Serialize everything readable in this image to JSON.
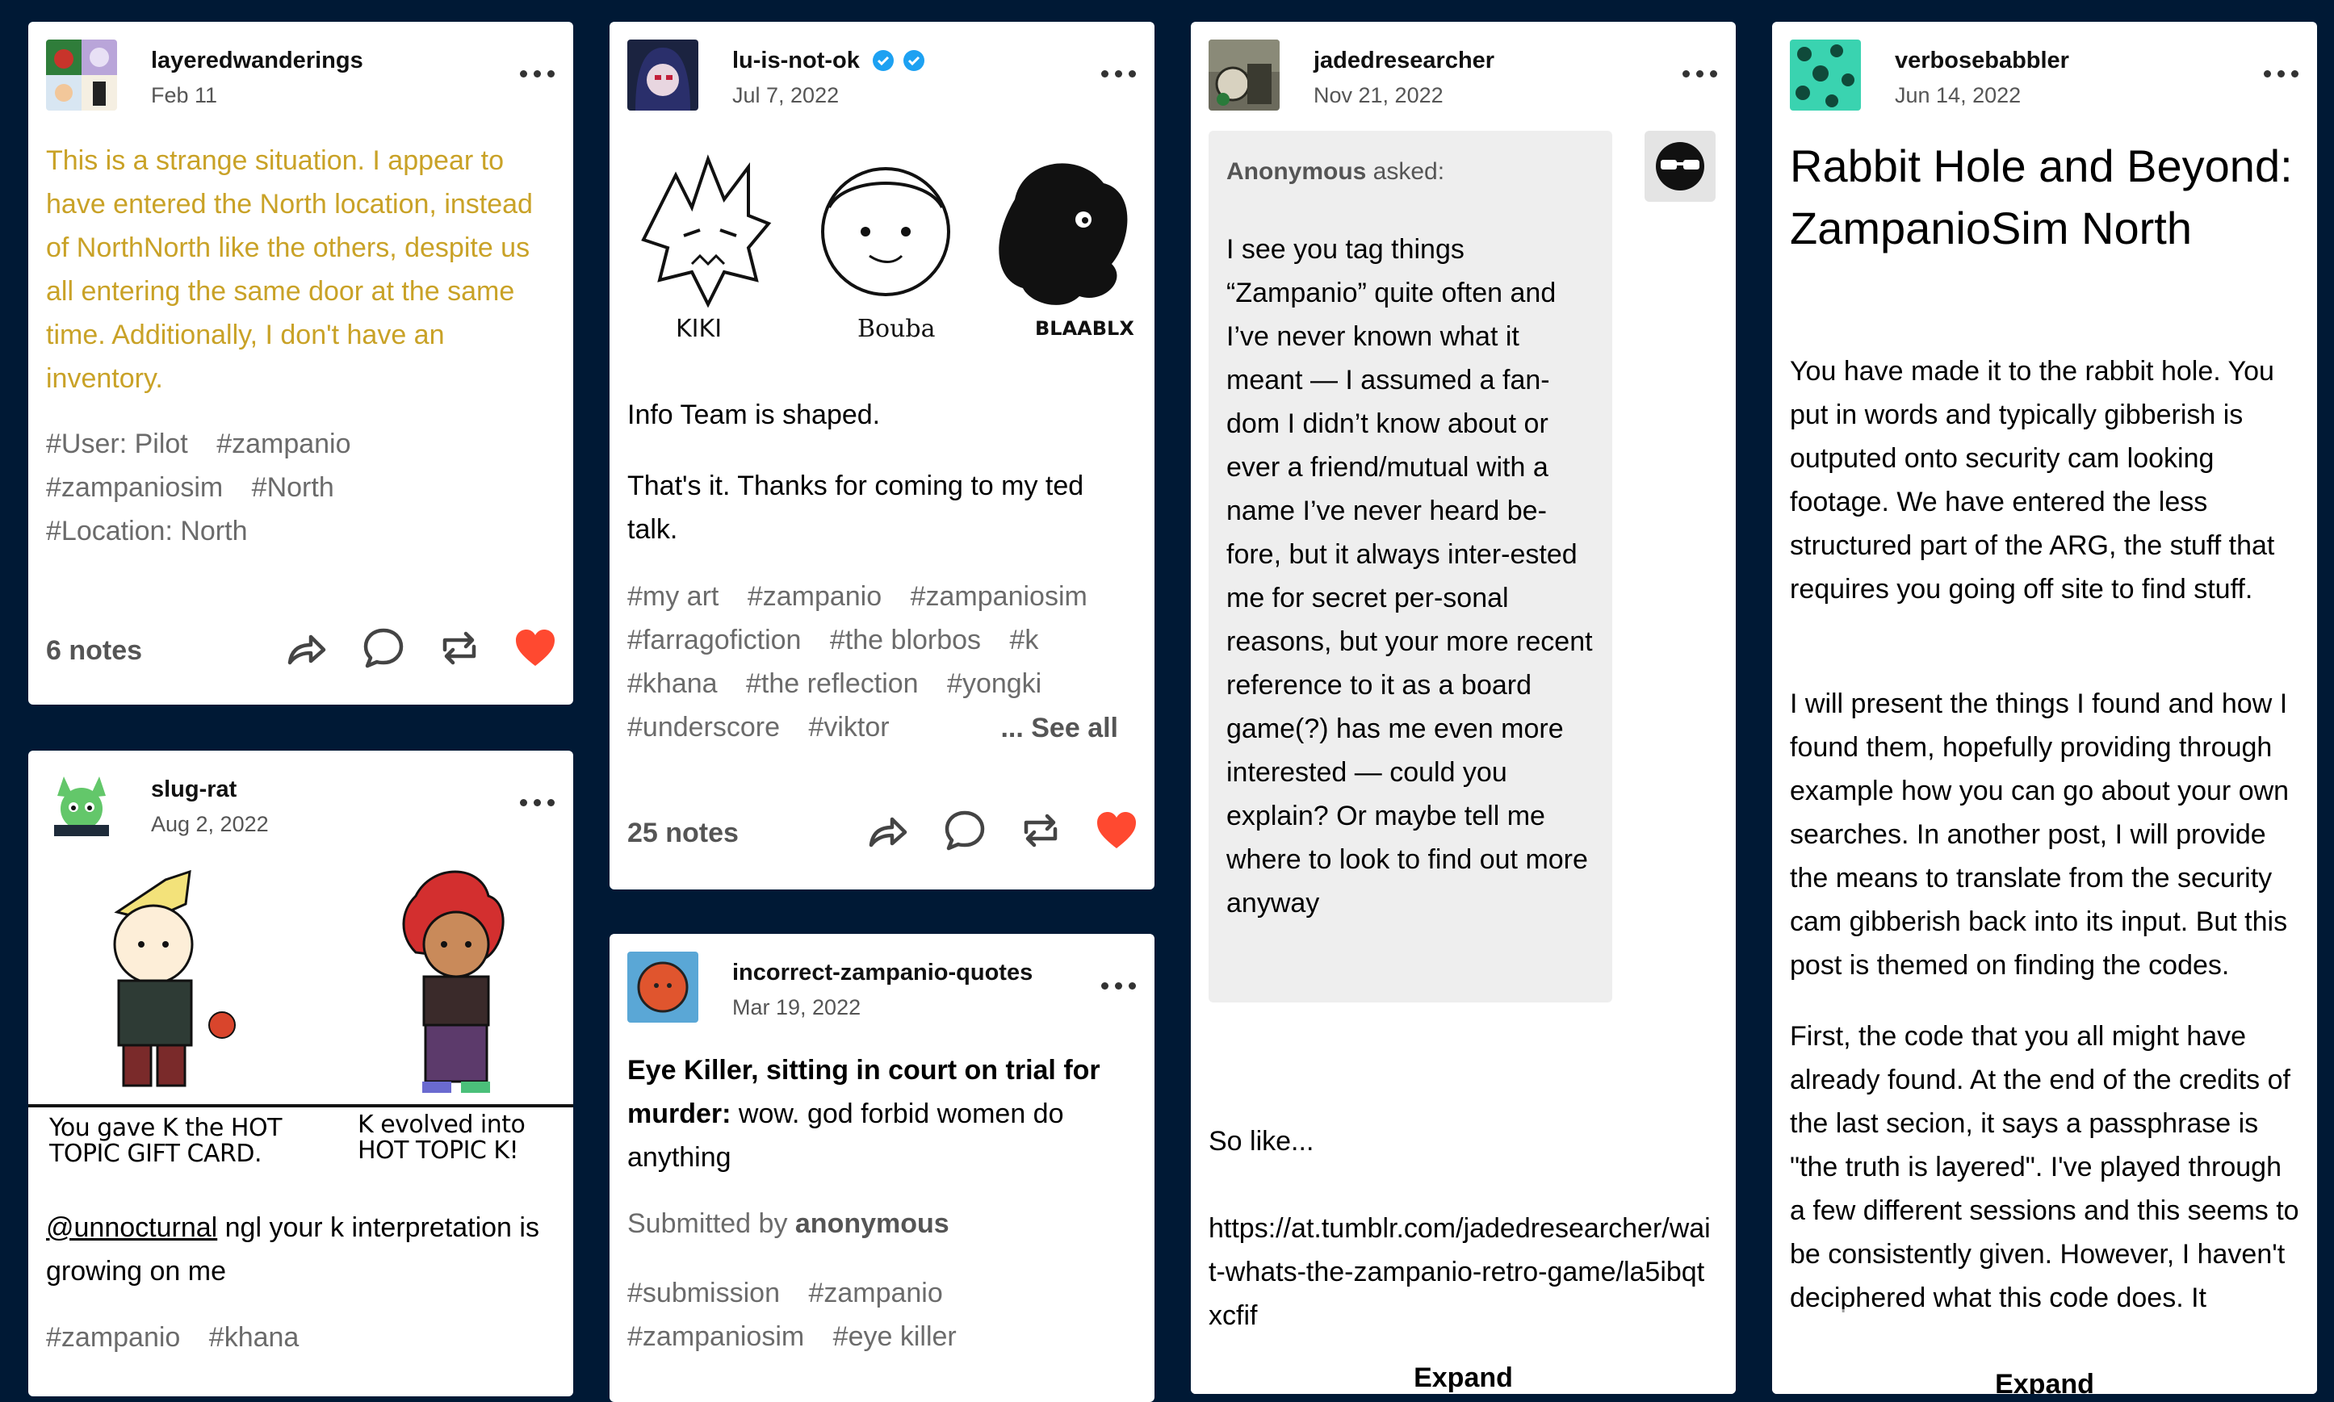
{
  "colors": {
    "background": "#001935",
    "card": "#ffffff",
    "accent_yellow": "#c9a227",
    "like_red": "#ff4930",
    "tag_gray": "#6b6b6b",
    "verified_blue": "#1da1f2"
  },
  "posts": {
    "layered": {
      "username": "layeredwanderings",
      "date": "Feb 11",
      "text": "This is a strange situation. I appear to have entered the North location, instead of NorthNorth like the others, despite us all entering the same door at the same time. Additionally, I don't have an inventory.",
      "tags": [
        "#User: Pilot",
        "#zampanio",
        "#zampaniosim",
        "#North",
        "#Location: North"
      ],
      "notes": "6 notes"
    },
    "slug": {
      "username": "slug-rat",
      "date": "Aug 2, 2022",
      "caption_left": "You gave K the HOT TOPIC GIFT CARD.",
      "caption_right": "K evolved into HOT TOPIC K!",
      "mention": "@unnocturnal",
      "text": " ngl your k interpretation is growing on me",
      "tags": [
        "#zampanio",
        "#khana"
      ]
    },
    "lu": {
      "username": "lu-is-not-ok",
      "date": "Jul 7, 2022",
      "fig_labels": [
        "KIKI",
        "Bouba",
        "BLAABLX"
      ],
      "p1": "Info Team is shaped.",
      "p2": "That's it. Thanks for coming to my ted talk.",
      "tags": [
        "#my art",
        "#zampanio",
        "#zampaniosim",
        "#farragofiction",
        "#the blorbos",
        "#k",
        "#khana",
        "#the reflection",
        "#yongki",
        "#underscore",
        "#viktor"
      ],
      "see_all": "... See all",
      "notes": "25 notes"
    },
    "incorrect": {
      "username": "incorrect-zampanio-quotes",
      "date": "Mar 19, 2022",
      "bold": "Eye Killer, sitting in court on trial for murder:",
      "text": " wow. god forbid women do anything",
      "submitted_prefix": "Submitted by ",
      "submitted_by": "anonymous",
      "tags": [
        "#submission",
        "#zampanio",
        "#zampaniosim",
        "#eye killer"
      ]
    },
    "jaded": {
      "username": "jadedresearcher",
      "date": "Nov 21, 2022",
      "asker": "Anonymous",
      "asked": " asked:",
      "question": "I see you tag things “Zampanio” quite often and I’ve never known what it meant — I assumed a fan-dom I didn’t know about or ever a friend/mutual with a name I’ve never heard be-fore, but it always inter-ested me for secret per-sonal reasons, but your more recent reference to it as a board game(?) has me even more interested — could you explain? Or maybe tell me where to look to find out more anyway",
      "answer": "So like...",
      "link": "https://at.tumblr.com/jadedresearcher/wait-whats-the-zampanio-retro-game/la5ibqtxcfif",
      "expand": "Expand"
    },
    "verbose": {
      "username": "verbosebabbler",
      "date": "Jun 14, 2022",
      "title": "Rabbit Hole and Beyond: ZampanioSim North",
      "p1": "You have made it to the rabbit hole. You put in words and typically gibberish is outputed onto security cam looking footage. We have entered the less structured part of the ARG, the stuff that requires you going off site to find stuff.",
      "p2": "I will present the things I found and how I found them, hopefully providing through example how you can go about your own searches. In another post, I will provide the means to translate from the security cam gibberish back into its input. But this post is themed on finding the codes.",
      "p3": "First, the code that you all might have already found. At the end of the credits of the last secion, it says a passphrase is \"the truth is layered\". I've played through a few different sessions and this seems to be consistently given. However, I haven't deciphered what this code does. It",
      "expand": "Expand"
    }
  }
}
